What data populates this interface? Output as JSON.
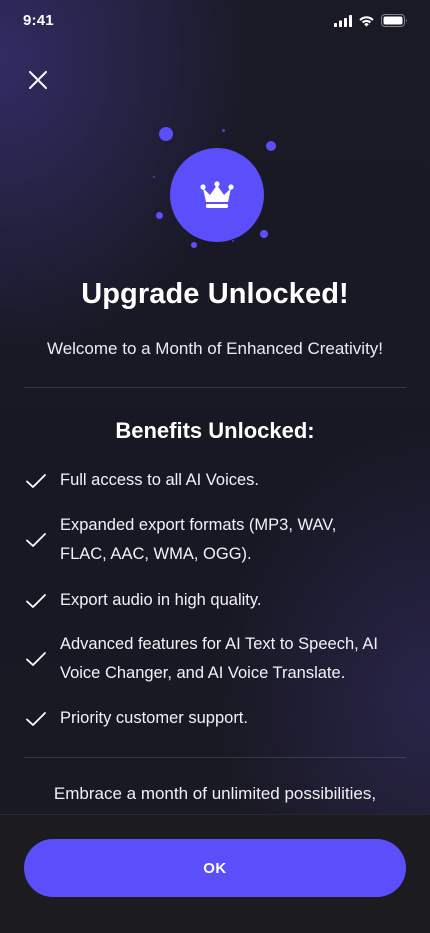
{
  "status_bar": {
    "time": "9:41"
  },
  "icons": {
    "close": "close-icon",
    "crown": "crown-icon",
    "check": "checkmark-icon"
  },
  "colors": {
    "accent": "#5b4efb",
    "background": "#1a1a27",
    "footer": "#1c1c20"
  },
  "header": {
    "title": "Upgrade Unlocked!",
    "subtitle": "Welcome to a Month of Enhanced Creativity!"
  },
  "benefits": {
    "heading": "Benefits Unlocked:",
    "items": [
      {
        "text": "Full access to all AI Voices."
      },
      {
        "text": "Expanded export formats (MP3, WAV, FLAC, AAC, WMA, OGG)."
      },
      {
        "text": "Export audio in high quality."
      },
      {
        "text": "Advanced features for AI Text to Speech, AI Voice Changer, and AI Voice Translate."
      },
      {
        "text": "Priority customer support."
      }
    ]
  },
  "closing_text": "Embrace a month of unlimited possibilities,",
  "footer": {
    "ok_label": "OK"
  }
}
